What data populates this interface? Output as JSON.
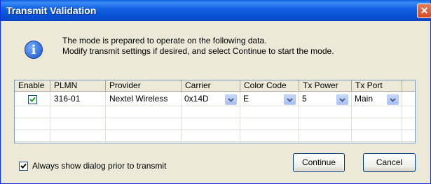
{
  "window": {
    "title": "Transmit Validation"
  },
  "message": {
    "line1": "The mode is prepared to operate on the following data.",
    "line2": "Modify transmit settings if desired, and select Continue to start the mode."
  },
  "grid": {
    "columns": [
      "Enable",
      "PLMN",
      "Provider",
      "Carrier",
      "Color Code",
      "Tx Power",
      "Tx Port"
    ],
    "rows": [
      {
        "enable": true,
        "plmn": "316-01",
        "provider": "Nextel Wireless",
        "carrier": "0x14D",
        "color_code": "E",
        "tx_power": "5",
        "tx_port": "Main"
      }
    ]
  },
  "options": {
    "always_show_label": "Always show dialog prior to transmit",
    "always_show_checked": true
  },
  "buttons": {
    "continue": "Continue",
    "cancel": "Cancel"
  },
  "colors": {
    "titlebar": "#0a5fe0",
    "dialog_bg": "#ece9d8",
    "close": "#d84a25"
  },
  "icons": {
    "info": "info-icon",
    "close": "close-icon",
    "dropdown": "chevron-down-icon"
  }
}
